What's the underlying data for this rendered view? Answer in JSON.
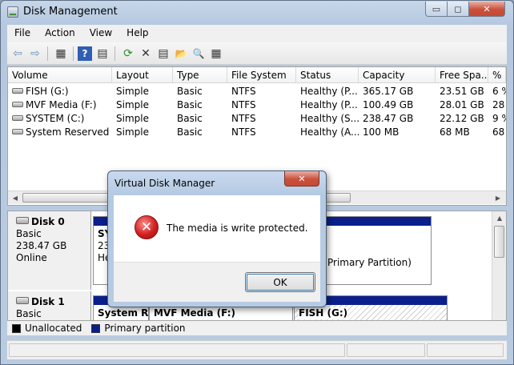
{
  "window": {
    "title": "Disk Management",
    "min_glyph": "▭",
    "max_glyph": "◻",
    "close_glyph": "✕"
  },
  "menu": [
    "File",
    "Action",
    "View",
    "Help"
  ],
  "toolbar": {
    "back_glyph": "⇦",
    "forward_glyph": "⇨",
    "refresh_glyph": "⟳",
    "delete_glyph": "✕",
    "help_glyph": "?",
    "properties_glyph": "▤",
    "open_glyph": "📂",
    "search_glyph": "🔍",
    "console_glyph": "▦"
  },
  "volume_table": {
    "columns": [
      "Volume",
      "Layout",
      "Type",
      "File System",
      "Status",
      "Capacity",
      "Free Spa...",
      "%"
    ],
    "rows": [
      {
        "volume": "FISH (G:)",
        "layout": "Simple",
        "type": "Basic",
        "fs": "NTFS",
        "status": "Healthy (P...",
        "capacity": "365.17 GB",
        "free": "23.51 GB",
        "pct": "6 %"
      },
      {
        "volume": "MVF Media (F:)",
        "layout": "Simple",
        "type": "Basic",
        "fs": "NTFS",
        "status": "Healthy (P...",
        "capacity": "100.49 GB",
        "free": "28.01 GB",
        "pct": "28"
      },
      {
        "volume": "SYSTEM (C:)",
        "layout": "Simple",
        "type": "Basic",
        "fs": "NTFS",
        "status": "Healthy (S...",
        "capacity": "238.47 GB",
        "free": "22.12 GB",
        "pct": "9 %"
      },
      {
        "volume": "System Reserved (...",
        "layout": "Simple",
        "type": "Basic",
        "fs": "NTFS",
        "status": "Healthy (A...",
        "capacity": "100 MB",
        "free": "68 MB",
        "pct": "68"
      }
    ]
  },
  "disks": [
    {
      "name": "Disk 0",
      "type": "Basic",
      "size": "238.47 GB",
      "state": "Online",
      "partitions": [
        {
          "label": "SYS",
          "line2": "23",
          "line3": "He"
        },
        {
          "label": "",
          "line2": "",
          "line3": "Primary Partition)"
        }
      ]
    },
    {
      "name": "Disk 1",
      "type": "Basic",
      "partitions": [
        {
          "label": "System Re"
        },
        {
          "label": "MVF Media  (F:)"
        },
        {
          "label": "FISH  (G:)"
        }
      ]
    }
  ],
  "legend": [
    {
      "label": "Unallocated",
      "color": "#000000"
    },
    {
      "label": "Primary partition",
      "color": "#0a1f8b"
    }
  ],
  "dialog": {
    "title": "Virtual Disk Manager",
    "close_glyph": "✕",
    "error_glyph": "✕",
    "message": "The media is write protected.",
    "ok_label": "OK"
  }
}
